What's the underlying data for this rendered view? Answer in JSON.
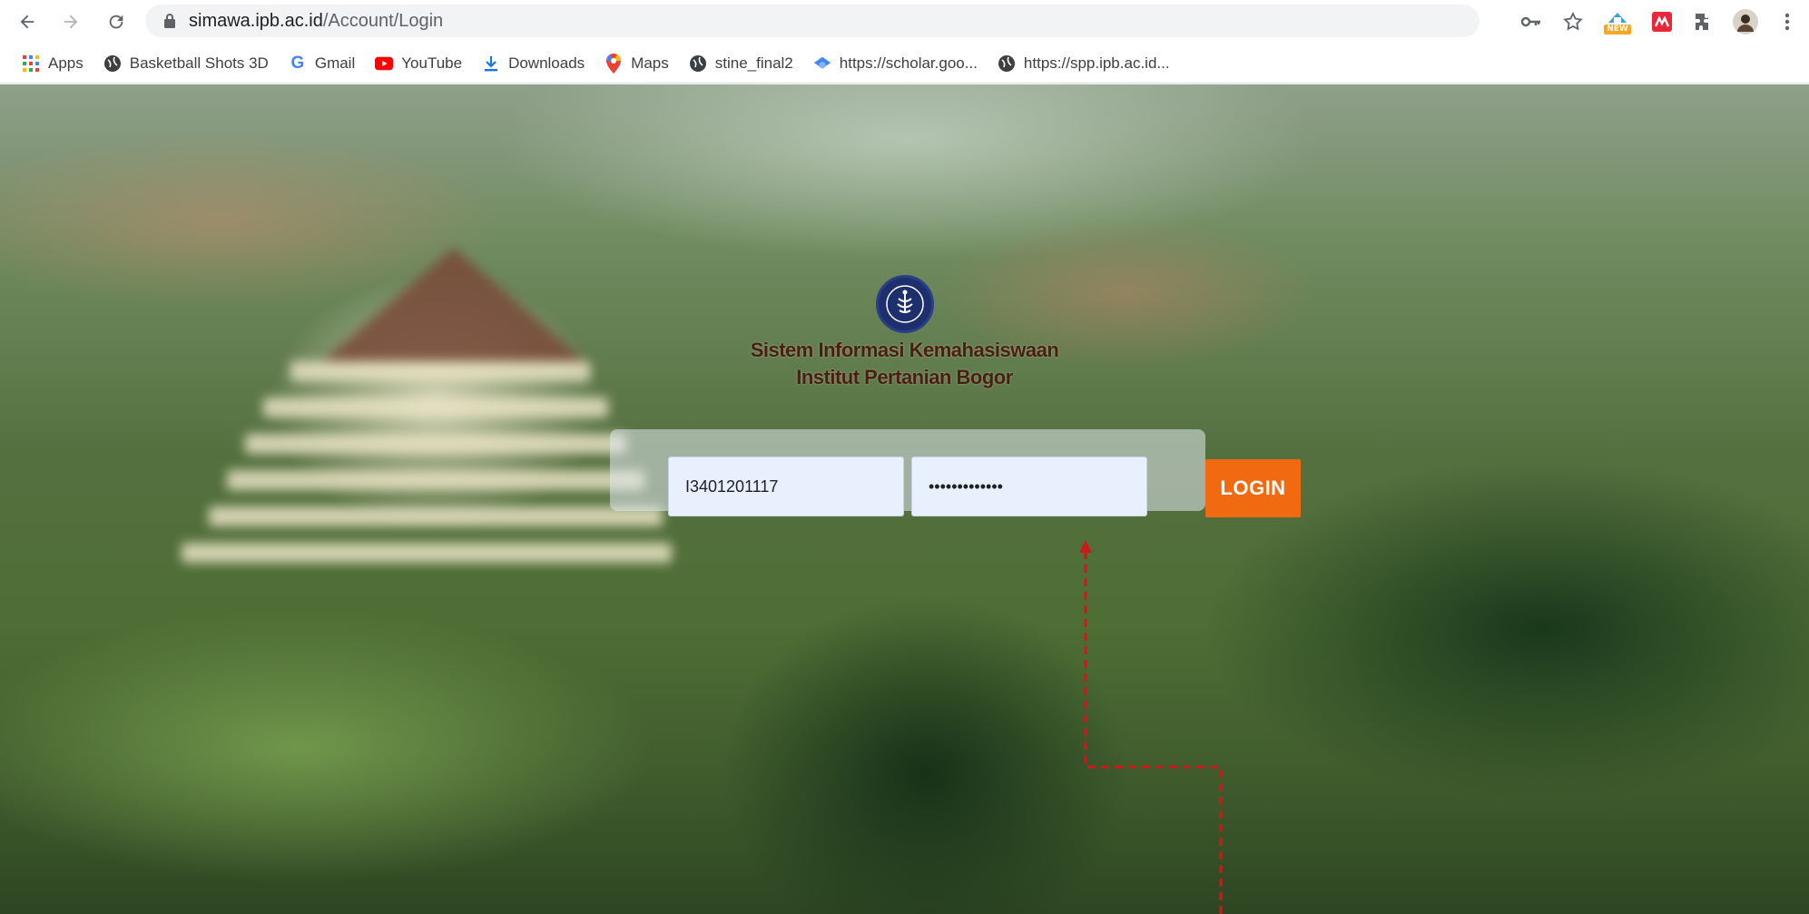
{
  "browser": {
    "url_host": "simawa.ipb.ac.id",
    "url_path": "/Account/Login",
    "toolbar_icons": [
      "back-icon",
      "forward-icon",
      "reload-icon",
      "lock-icon",
      "key-icon",
      "star-icon",
      "extension-new-icon",
      "extension-red-icon",
      "puzzle-icon",
      "profile-avatar",
      "kebab-menu-icon"
    ],
    "extension_badge": "NEW"
  },
  "bookmarks": [
    {
      "label": "Apps",
      "icon": "apps-grid-icon"
    },
    {
      "label": "Basketball Shots 3D",
      "icon": "globe-icon"
    },
    {
      "label": "Gmail",
      "icon": "google-icon"
    },
    {
      "label": "YouTube",
      "icon": "youtube-icon"
    },
    {
      "label": "Downloads",
      "icon": "download-icon"
    },
    {
      "label": "Maps",
      "icon": "maps-pin-icon"
    },
    {
      "label": "stine_final2",
      "icon": "globe-icon"
    },
    {
      "label": "https://scholar.goo...",
      "icon": "scholar-icon"
    },
    {
      "label": "https://spp.ipb.ac.id...",
      "icon": "globe-icon"
    }
  ],
  "page": {
    "title_line1": "Sistem Informasi Kemahasiswaan",
    "title_line2": "Institut Pertanian Bogor",
    "username_value": "I3401201117",
    "password_value": "•••••••••••••",
    "login_label": "LOGIN"
  },
  "colors": {
    "login_button": "#f26a10",
    "title_text": "#4a1f12",
    "annotation_arrow": "#cc1a1a",
    "input_background": "#e8f0fe"
  }
}
